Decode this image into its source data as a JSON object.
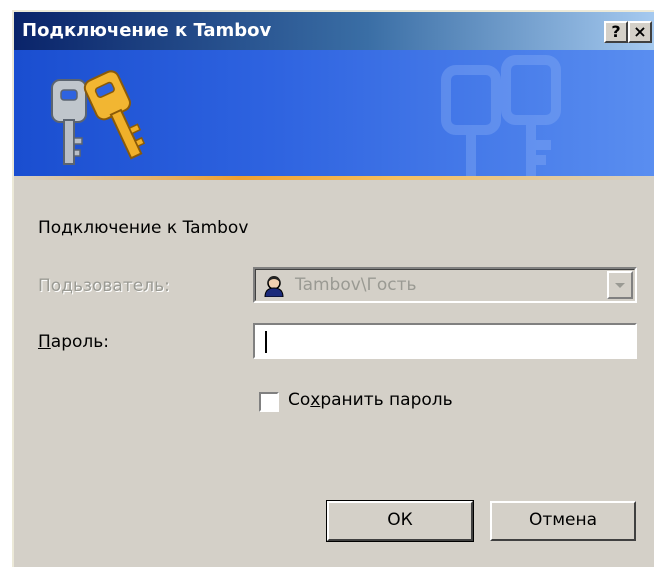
{
  "window": {
    "title": "Подключение к Tambov",
    "help_button": "?",
    "close_button": "×"
  },
  "dialog": {
    "heading": "Подключение к Tambov",
    "user_label_pre": "По",
    "user_label_acc": "д",
    "user_label_post": "ьзователь:",
    "user_value": "Tambov\\Гость",
    "password_label_acc": "П",
    "password_label_post": "ароль:",
    "password_value": "",
    "save_password_pre": "Со",
    "save_password_acc": "х",
    "save_password_post": "ранить пароль",
    "save_password_checked": false,
    "ok_label": "ОК",
    "cancel_label": "Отмена"
  },
  "colors": {
    "dialog_bg": "#d4d0c8",
    "title_gradient_start": "#0a246a",
    "banner_blue": "#2e63e0",
    "disabled_text": "#9a9a93"
  },
  "icons": {
    "banner": "keys-icon",
    "user": "user-icon",
    "dropdown": "chevron-down-icon"
  }
}
